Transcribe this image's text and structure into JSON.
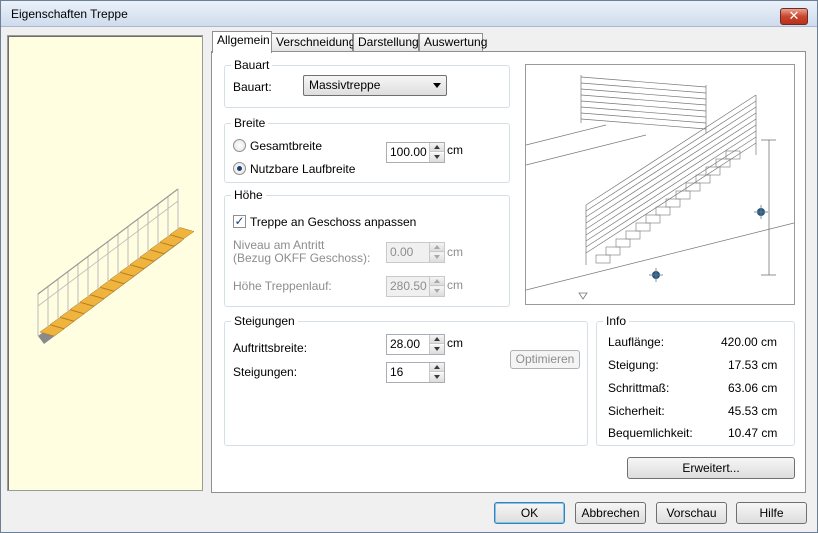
{
  "window": {
    "title": "Eigenschaften Treppe",
    "close_glyph": "✕"
  },
  "tabs": [
    {
      "label": "Allgemein"
    },
    {
      "label": "Verschneidung"
    },
    {
      "label": "Darstellung"
    },
    {
      "label": "Auswertung"
    }
  ],
  "bauart": {
    "group": "Bauart",
    "label": "Bauart:",
    "value": "Massivtreppe"
  },
  "breite": {
    "group": "Breite",
    "option1": "Gesamtbreite",
    "option2": "Nutzbare Laufbreite",
    "value": "100.00",
    "unit": "cm"
  },
  "hoehe": {
    "group": "Höhe",
    "checkbox": "Treppe an Geschoss anpassen",
    "niveau_label_1": "Niveau am Antritt",
    "niveau_label_2": "(Bezug OKFF Geschoss):",
    "niveau_value": "0.00",
    "niveau_unit": "cm",
    "lauf_label": "Höhe Treppenlauf:",
    "lauf_value": "280.50",
    "lauf_unit": "cm"
  },
  "steigungen": {
    "group": "Steigungen",
    "auftritt_label": "Auftrittsbreite:",
    "auftritt_value": "28.00",
    "auftritt_unit": "cm",
    "count_label": "Steigungen:",
    "count_value": "16",
    "optimize_label": "Optimieren"
  },
  "info": {
    "group": "Info",
    "rows": [
      {
        "label": "Lauflänge:",
        "value": "420.00 cm"
      },
      {
        "label": "Steigung:",
        "value": "17.53 cm"
      },
      {
        "label": "Schrittmaß:",
        "value": "63.06 cm"
      },
      {
        "label": "Sicherheit:",
        "value": "45.53 cm"
      },
      {
        "label": "Bequemlichkeit:",
        "value": "10.47 cm"
      }
    ]
  },
  "buttons": {
    "erweitert": "Erweitert...",
    "ok": "OK",
    "abbrechen": "Abbrechen",
    "vorschau": "Vorschau",
    "hilfe": "Hilfe"
  },
  "colors": {
    "tread": "#f0b43c",
    "stringer": "#8a8a8a",
    "preview_bg": "#fffee0",
    "marker": "#1f5a8a"
  }
}
